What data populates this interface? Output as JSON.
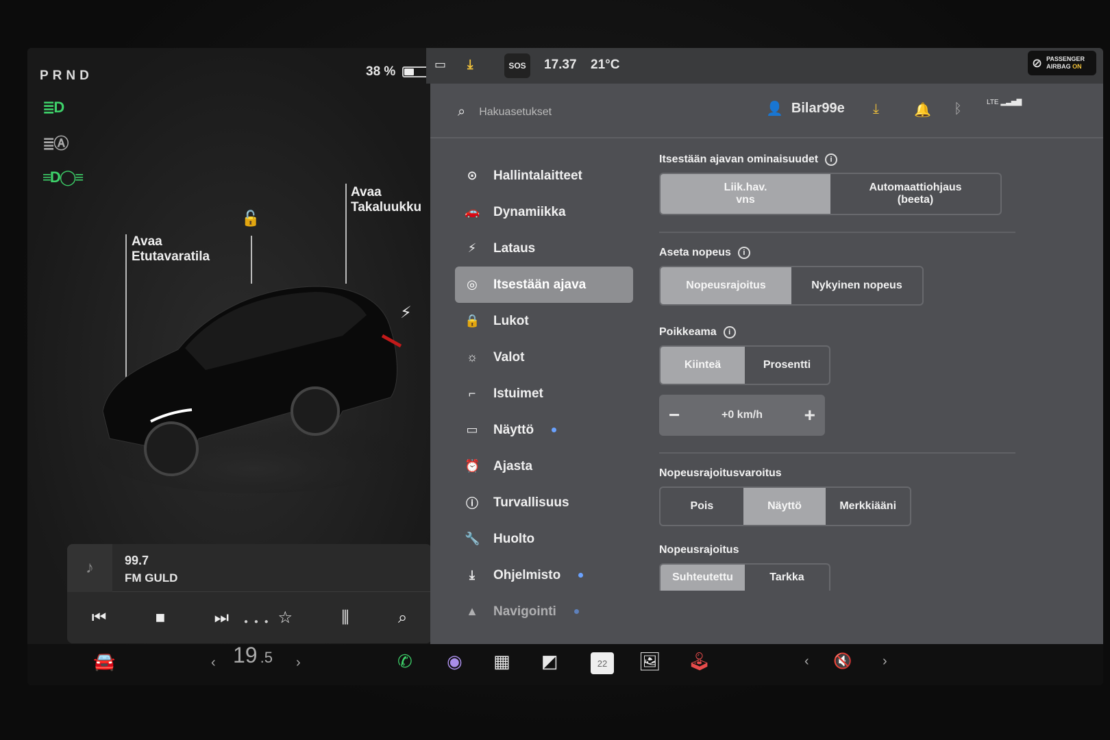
{
  "gear": "PRND",
  "battery": {
    "percent_label": "38 %",
    "level_fraction": 0.38
  },
  "car_labels": {
    "frunk": [
      "Avaa",
      "Etutavaratila"
    ],
    "trunk": [
      "Avaa",
      "Takaluukku"
    ]
  },
  "media": {
    "frequency": "99.7",
    "station": "FM GULD"
  },
  "status_bar": {
    "sos": "SOS",
    "time": "17.37",
    "temperature": "21°C",
    "airbag": [
      "PASSENGER",
      "AIRBAG"
    ],
    "airbag_state": "ON"
  },
  "topbar": {
    "search_placeholder": "Hakuasetukset",
    "user": "Bilar99e",
    "network": "LTE"
  },
  "menu": [
    {
      "label": "Hallintalaitteet",
      "icon": "toggle-icon"
    },
    {
      "label": "Dynamiikka",
      "icon": "car-icon"
    },
    {
      "label": "Lataus",
      "icon": "bolt-icon"
    },
    {
      "label": "Itsestään ajava",
      "icon": "steering-wheel-icon"
    },
    {
      "label": "Lukot",
      "icon": "lock-icon"
    },
    {
      "label": "Valot",
      "icon": "sun-icon"
    },
    {
      "label": "Istuimet",
      "icon": "seat-icon"
    },
    {
      "label": "Näyttö",
      "icon": "display-icon"
    },
    {
      "label": "Ajasta",
      "icon": "alarm-icon"
    },
    {
      "label": "Turvallisuus",
      "icon": "alert-icon"
    },
    {
      "label": "Huolto",
      "icon": "wrench-icon"
    },
    {
      "label": "Ohjelmisto",
      "icon": "download-icon"
    },
    {
      "label": "Navigointi",
      "icon": "navigation-icon"
    }
  ],
  "settings": {
    "autopilot_title": "Itsestään ajavan ominaisuudet",
    "autopilot_options": [
      "Liik.hav.\nvns",
      "Automaattiohjaus\n(beeta)"
    ],
    "speed_title": "Aseta nopeus",
    "speed_options": [
      "Nopeusrajoitus",
      "Nykyinen nopeus"
    ],
    "offset_title": "Poikkeama",
    "offset_options": [
      "Kiinteä",
      "Prosentti"
    ],
    "offset_value": "+0 km/h",
    "warning_title": "Nopeusrajoitusvaroitus",
    "warning_options": [
      "Pois",
      "Näyttö",
      "Merkkiääni"
    ],
    "limit_title": "Nopeusrajoitus",
    "limit_options": [
      "Suhteutettu",
      "Tarkka"
    ]
  },
  "dock": {
    "cabin_temp_main": "19",
    "cabin_temp_decimal": ".5",
    "calendar_day": "22"
  }
}
